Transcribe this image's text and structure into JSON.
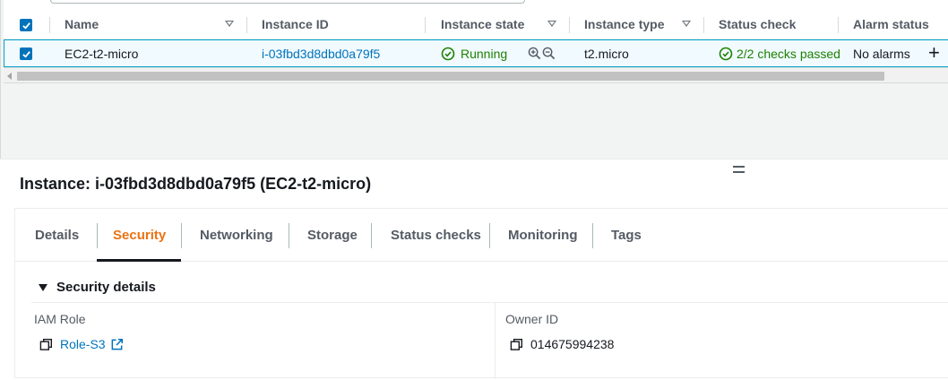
{
  "table": {
    "columns": [
      "Name",
      "Instance ID",
      "Instance state",
      "Instance type",
      "Status check",
      "Alarm status"
    ],
    "row": {
      "selected": true,
      "name": "EC2-t2-micro",
      "instance_id": "i-03fbd3d8dbd0a79f5",
      "state": "Running",
      "type": "t2.micro",
      "status_check": "2/2 checks passed",
      "alarm_status": "No alarms"
    }
  },
  "panel": {
    "title": "Instance: i-03fbd3d8dbd0a79f5 (EC2-t2-micro)",
    "tabs": [
      "Details",
      "Security",
      "Networking",
      "Storage",
      "Status checks",
      "Monitoring",
      "Tags"
    ],
    "active_tab": "Security",
    "section_title": "Security details",
    "iam_role_label": "IAM Role",
    "iam_role_value": "Role-S3",
    "owner_id_label": "Owner ID",
    "owner_id_value": "014675994238"
  },
  "colors": {
    "accent": "#0073bb",
    "active_tab": "#ec7211",
    "success": "#1d8102",
    "selected_row_bg": "#f1faff"
  },
  "icons": [
    "checkbox-checked",
    "sort-caret-icon",
    "check-circle-icon",
    "zoom-in-icon",
    "zoom-out-icon",
    "plus-icon",
    "copy-icon",
    "external-link-icon",
    "caret-down-icon",
    "drag-handle-icon"
  ]
}
